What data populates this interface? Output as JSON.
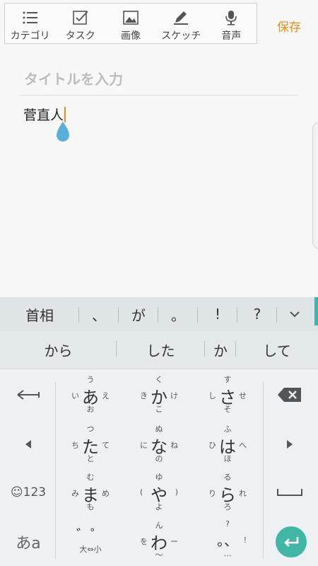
{
  "toolbar": {
    "items": [
      {
        "label": "カテゴリ",
        "icon": "list-icon"
      },
      {
        "label": "タスク",
        "icon": "checkbox-icon"
      },
      {
        "label": "画像",
        "icon": "image-icon"
      },
      {
        "label": "スケッチ",
        "icon": "pen-icon"
      },
      {
        "label": "音声",
        "icon": "microphone-icon"
      }
    ],
    "save": "保存"
  },
  "note": {
    "title_placeholder": "タイトルを入力",
    "body": "菅直人"
  },
  "suggestions": {
    "row1": [
      "首相",
      "、",
      "が",
      "。",
      "!",
      "?"
    ],
    "row2": [
      "から",
      "した",
      "か",
      "して"
    ]
  },
  "keyboard": {
    "keys": {
      "a": {
        "main": "あ",
        "top": "う",
        "bottom": "お",
        "left": "い",
        "right": "え"
      },
      "ka": {
        "main": "か",
        "top": "く",
        "bottom": "こ",
        "left": "き",
        "right": "け"
      },
      "sa": {
        "main": "さ",
        "top": "す",
        "bottom": "そ",
        "left": "し",
        "right": "せ"
      },
      "ta": {
        "main": "た",
        "top": "つ",
        "bottom": "と",
        "left": "ち",
        "right": "て"
      },
      "na": {
        "main": "な",
        "top": "ぬ",
        "bottom": "の",
        "left": "に",
        "right": "ね"
      },
      "ha": {
        "main": "は",
        "top": "ふ",
        "bottom": "ほ",
        "left": "ひ",
        "right": "へ"
      },
      "ma": {
        "main": "ま",
        "top": "む",
        "bottom": "も",
        "left": "み",
        "right": "め"
      },
      "ya": {
        "main": "や",
        "top": "ゆ",
        "bottom": "よ",
        "left": "(",
        "right": ")"
      },
      "ra": {
        "main": "ら",
        "top": "る",
        "bottom": "ろ",
        "left": "り",
        "right": "れ"
      },
      "dakuten": {
        "main": "゛゜",
        "bottom": "大⇔小"
      },
      "wa": {
        "main": "わ",
        "top": "ん",
        "bottom": "〜",
        "left": "を",
        "right": "ー"
      },
      "punct": {
        "main": "。、",
        "top": "?",
        "bottom": "…",
        "right": "!"
      }
    },
    "symbols_label": "☺123",
    "mode_label": "あa"
  },
  "colors": {
    "accent": "#e0901b",
    "teal": "#41b6a7"
  }
}
